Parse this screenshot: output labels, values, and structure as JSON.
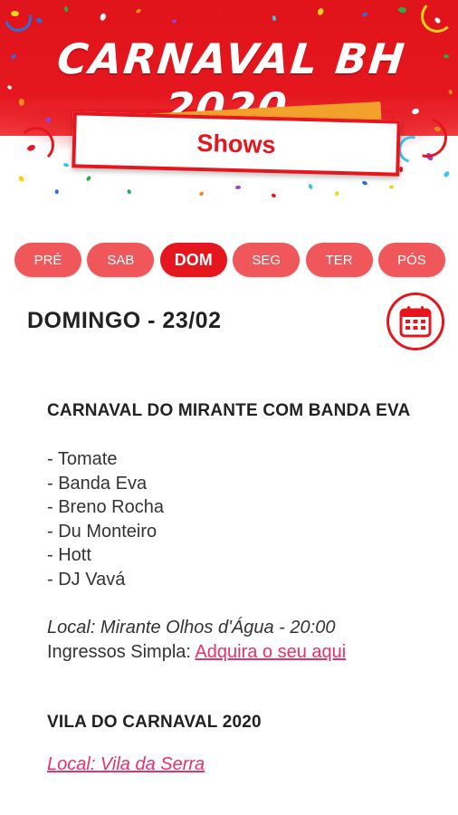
{
  "header": {
    "app_title": "CARNAVAL BH  2020",
    "section_label": "Shows"
  },
  "tabs": [
    {
      "label": "PRÉ",
      "active": false
    },
    {
      "label": "SAB",
      "active": false
    },
    {
      "label": "DOM",
      "active": true
    },
    {
      "label": "SEG",
      "active": false
    },
    {
      "label": "TER",
      "active": false
    },
    {
      "label": "PÓS",
      "active": false
    }
  ],
  "day": {
    "heading": "DOMINGO - 23/02",
    "calendar_icon": "calendar-icon"
  },
  "events": [
    {
      "title": "CARNAVAL DO MIRANTE COM BANDA EVA",
      "lineup": [
        "- Tomate",
        "- Banda Eva",
        "- Breno Rocha",
        "- Du Monteiro",
        "- Hott",
        "- DJ Vavá"
      ],
      "local": "Local: Mirante Olhos d'Água - 20:00",
      "tickets_prefix": "Ingressos Simpla: ",
      "tickets_link": "Adquira o seu aqui"
    },
    {
      "title": "VILA DO CARNAVAL 2020",
      "local_link": "Local: Vila da Serra"
    }
  ],
  "colors": {
    "brand_red": "#e5161e",
    "tab_inactive": "#f0575b",
    "link_pink": "#e8306a",
    "accent_orange": "#f2a12a"
  }
}
